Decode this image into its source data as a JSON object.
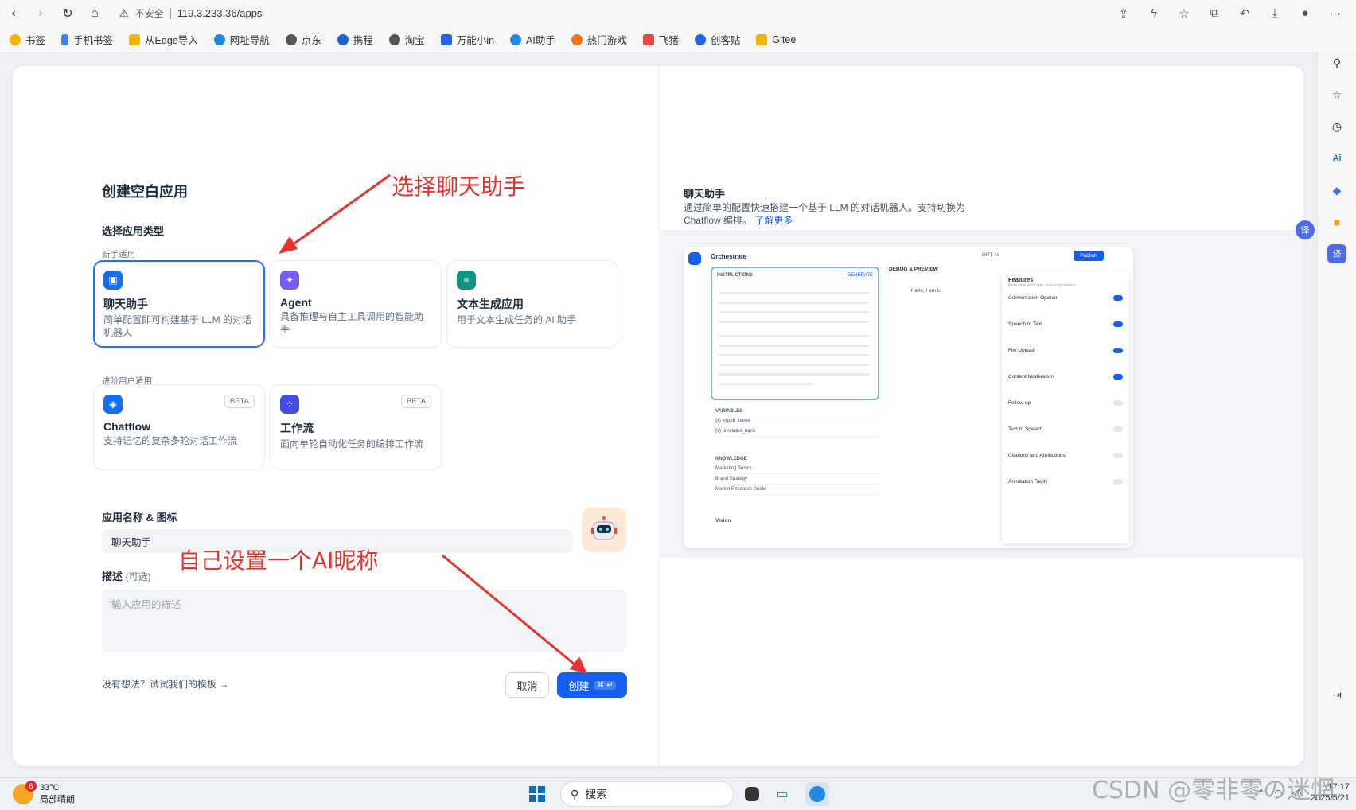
{
  "browser": {
    "insecure_label": "不安全",
    "url": "119.3.233.36/apps"
  },
  "bookmarks": [
    "书签",
    "手机书签",
    "从Edge导入",
    "网址导航",
    "京东",
    "携程",
    "淘宝",
    "万能小in",
    "AI助手",
    "热门游戏",
    "飞猪",
    "创客贴",
    "Gitee"
  ],
  "modal": {
    "title": "创建空白应用",
    "type_label": "选择应用类型",
    "beginner_label": "新手适用",
    "advanced_label": "进阶用户适用",
    "cards": [
      {
        "title": "聊天助手",
        "desc": "简单配置即可构建基于 LLM 的对话机器人"
      },
      {
        "title": "Agent",
        "desc": "具备推理与自主工具调用的智能助手"
      },
      {
        "title": "文本生成应用",
        "desc": "用于文本生成任务的 AI 助手"
      },
      {
        "title": "Chatflow",
        "desc": "支持记忆的复杂多轮对话工作流",
        "badge": "BETA"
      },
      {
        "title": "工作流",
        "desc": "面向单轮自动化任务的编排工作流",
        "badge": "BETA"
      }
    ],
    "name_label": "应用名称 & 图标",
    "name_value": "聊天助手",
    "desc_label": "描述",
    "desc_optional": "(可选)",
    "desc_placeholder": "输入应用的描述",
    "template_link": "没有想法？试试我们的模板",
    "cancel": "取消",
    "create": "创建",
    "create_shortcut": "⌘ ↵"
  },
  "annotations": {
    "select_chat": "选择聊天助手",
    "set_name": "自己设置一个AI昵称"
  },
  "preview": {
    "title": "聊天助手",
    "desc": "通过简单的配置快速搭建一个基于 LLM 的对话机器人。支持切换为 Chatflow 编排。",
    "learn_more": "了解更多",
    "orchestrate": "Orchestrate",
    "model": "GPT-4o",
    "publish": "Publish",
    "instructions": "INSTRUCTIONS",
    "generate": "GENERATE",
    "debug": "DEBUG & PREVIEW",
    "hello": "Hello, I am L.",
    "variables": "VARIABLES",
    "vars": [
      "{x} expert_name",
      "{x} unrelated_topic"
    ],
    "knowledge": "KNOWLEDGE",
    "docs": [
      "Marketing Basics",
      "Brand Strategy",
      "Market Research Guide"
    ],
    "vision": "Vision",
    "features_title": "Features",
    "features_sub": "Enhance web app user experience",
    "features": [
      {
        "name": "Conversation Opener",
        "on": true
      },
      {
        "name": "Speech to Text",
        "on": true
      },
      {
        "name": "File Upload",
        "on": true
      },
      {
        "name": "Content Moderation",
        "on": true
      },
      {
        "name": "Follow-up",
        "on": false
      },
      {
        "name": "Text to Speech",
        "on": false
      },
      {
        "name": "Citations and Attributions",
        "on": false
      },
      {
        "name": "Annotation Reply",
        "on": false
      }
    ]
  },
  "taskbar": {
    "badge": "6",
    "temp": "33°C",
    "weather": "局部晴朗",
    "search": "搜索",
    "time": "17:17",
    "date": "2025/5/21"
  },
  "watermark": "CSDN @零非零の迷惘"
}
